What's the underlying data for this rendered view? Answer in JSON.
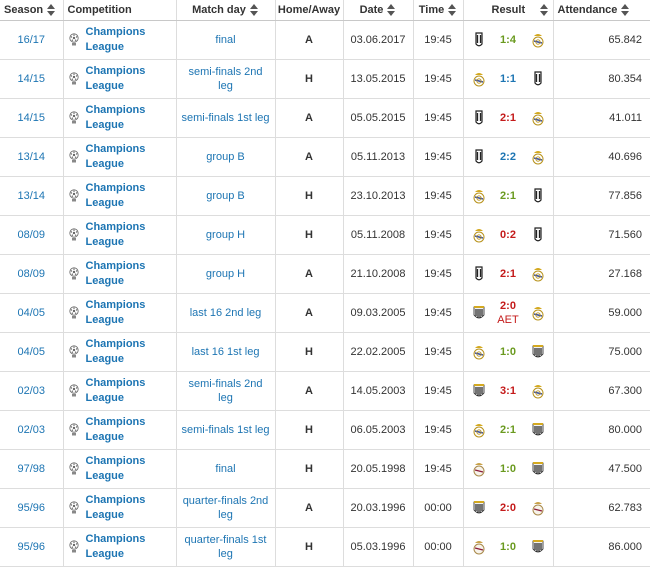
{
  "headers": {
    "season": "Season",
    "competition": "Competition",
    "matchday": "Match day",
    "homeaway": "Home/Away",
    "date": "Date",
    "time": "Time",
    "result": "Result",
    "attendance": "Attendance"
  },
  "colors": {
    "win": "#6a9a1f",
    "loss": "#c41a1a",
    "draw": "#1d75b3",
    "link": "#1d75b3"
  },
  "rows": [
    {
      "season": "16/17",
      "competition": "Champions League",
      "matchday": "final",
      "homeaway": "A",
      "date": "03.06.2017",
      "time": "19:45",
      "score": "1:4",
      "aet": "",
      "outcome": "win",
      "home_crest": "juventus-crest-icon",
      "away_crest": "real-madrid-crest-icon",
      "attendance": "65.842"
    },
    {
      "season": "14/15",
      "competition": "Champions League",
      "matchday": "semi-finals 2nd leg",
      "homeaway": "H",
      "date": "13.05.2015",
      "time": "19:45",
      "score": "1:1",
      "aet": "",
      "outcome": "draw",
      "home_crest": "real-madrid-crest-icon",
      "away_crest": "juventus-crest-icon",
      "attendance": "80.354"
    },
    {
      "season": "14/15",
      "competition": "Champions League",
      "matchday": "semi-finals 1st leg",
      "homeaway": "A",
      "date": "05.05.2015",
      "time": "19:45",
      "score": "2:1",
      "aet": "",
      "outcome": "loss",
      "home_crest": "juventus-crest-icon",
      "away_crest": "real-madrid-crest-icon",
      "attendance": "41.011"
    },
    {
      "season": "13/14",
      "competition": "Champions League",
      "matchday": "group B",
      "homeaway": "A",
      "date": "05.11.2013",
      "time": "19:45",
      "score": "2:2",
      "aet": "",
      "outcome": "draw",
      "home_crest": "juventus-crest-icon",
      "away_crest": "real-madrid-crest-icon",
      "attendance": "40.696"
    },
    {
      "season": "13/14",
      "competition": "Champions League",
      "matchday": "group B",
      "homeaway": "H",
      "date": "23.10.2013",
      "time": "19:45",
      "score": "2:1",
      "aet": "",
      "outcome": "win",
      "home_crest": "real-madrid-crest-icon",
      "away_crest": "juventus-crest-icon",
      "attendance": "77.856"
    },
    {
      "season": "08/09",
      "competition": "Champions League",
      "matchday": "group H",
      "homeaway": "H",
      "date": "05.11.2008",
      "time": "19:45",
      "score": "0:2",
      "aet": "",
      "outcome": "loss",
      "home_crest": "real-madrid-crest-icon",
      "away_crest": "juventus-crest-icon",
      "attendance": "71.560"
    },
    {
      "season": "08/09",
      "competition": "Champions League",
      "matchday": "group H",
      "homeaway": "A",
      "date": "21.10.2008",
      "time": "19:45",
      "score": "2:1",
      "aet": "",
      "outcome": "loss",
      "home_crest": "juventus-crest-icon",
      "away_crest": "real-madrid-crest-icon",
      "attendance": "27.168"
    },
    {
      "season": "04/05",
      "competition": "Champions League",
      "matchday": "last 16 2nd leg",
      "homeaway": "A",
      "date": "09.03.2005",
      "time": "19:45",
      "score": "2:0",
      "aet": "AET",
      "outcome": "loss",
      "home_crest": "juventus-old-crest-icon",
      "away_crest": "real-madrid-crest-icon",
      "attendance": "59.000"
    },
    {
      "season": "04/05",
      "competition": "Champions League",
      "matchday": "last 16 1st leg",
      "homeaway": "H",
      "date": "22.02.2005",
      "time": "19:45",
      "score": "1:0",
      "aet": "",
      "outcome": "win",
      "home_crest": "real-madrid-crest-icon",
      "away_crest": "juventus-old-crest-icon",
      "attendance": "75.000"
    },
    {
      "season": "02/03",
      "competition": "Champions League",
      "matchday": "semi-finals 2nd leg",
      "homeaway": "A",
      "date": "14.05.2003",
      "time": "19:45",
      "score": "3:1",
      "aet": "",
      "outcome": "loss",
      "home_crest": "juventus-old-crest-icon",
      "away_crest": "real-madrid-crest-icon",
      "attendance": "67.300"
    },
    {
      "season": "02/03",
      "competition": "Champions League",
      "matchday": "semi-finals 1st leg",
      "homeaway": "H",
      "date": "06.05.2003",
      "time": "19:45",
      "score": "2:1",
      "aet": "",
      "outcome": "win",
      "home_crest": "real-madrid-crest-icon",
      "away_crest": "juventus-old-crest-icon",
      "attendance": "80.000"
    },
    {
      "season": "97/98",
      "competition": "Champions League",
      "matchday": "final",
      "homeaway": "H",
      "date": "20.05.1998",
      "time": "19:45",
      "score": "1:0",
      "aet": "",
      "outcome": "win",
      "home_crest": "real-madrid-old-crest-icon",
      "away_crest": "juventus-old-crest-icon",
      "attendance": "47.500"
    },
    {
      "season": "95/96",
      "competition": "Champions League",
      "matchday": "quarter-finals 2nd leg",
      "homeaway": "A",
      "date": "20.03.1996",
      "time": "00:00",
      "score": "2:0",
      "aet": "",
      "outcome": "loss",
      "home_crest": "juventus-old-crest-icon",
      "away_crest": "real-madrid-old-crest-icon",
      "attendance": "62.783"
    },
    {
      "season": "95/96",
      "competition": "Champions League",
      "matchday": "quarter-finals 1st leg",
      "homeaway": "H",
      "date": "05.03.1996",
      "time": "00:00",
      "score": "1:0",
      "aet": "",
      "outcome": "win",
      "home_crest": "real-madrid-old-crest-icon",
      "away_crest": "juventus-old-crest-icon",
      "attendance": "86.000"
    }
  ]
}
